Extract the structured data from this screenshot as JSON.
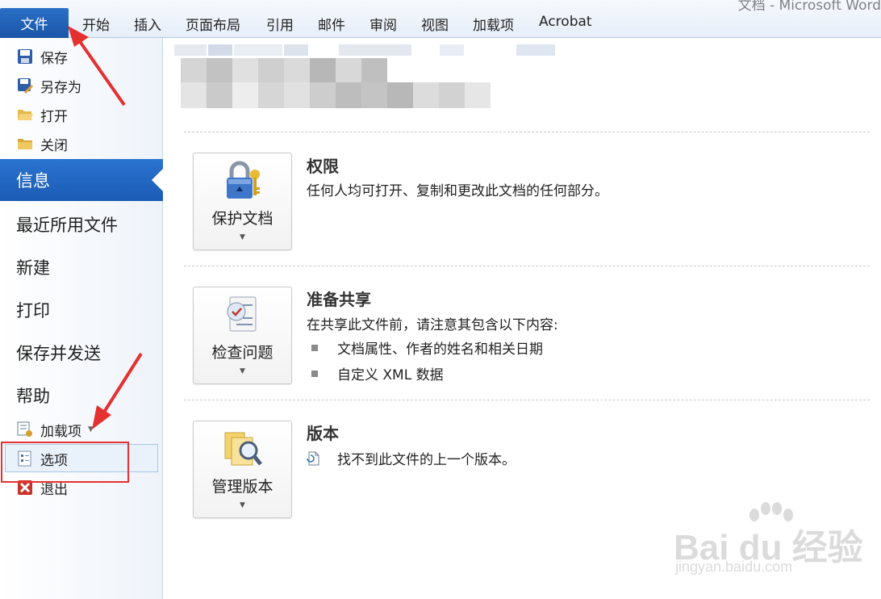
{
  "window": {
    "title_fragment": "文档 - Microsoft Word"
  },
  "ribbon": {
    "file_tab": "文件",
    "tabs": [
      "开始",
      "插入",
      "页面布局",
      "引用",
      "邮件",
      "审阅",
      "视图",
      "加载项",
      "Acrobat"
    ]
  },
  "backstage": {
    "commands_top": [
      {
        "label": "保存",
        "icon": "save-icon"
      },
      {
        "label": "另存为",
        "icon": "save-as-icon"
      },
      {
        "label": "打开",
        "icon": "open-folder-icon"
      },
      {
        "label": "关闭",
        "icon": "close-folder-icon"
      }
    ],
    "active_section": "信息",
    "sections": [
      "最近所用文件",
      "新建",
      "打印",
      "保存并发送",
      "帮助"
    ],
    "commands_bottom": [
      {
        "label": "加载项",
        "icon": "addins-icon",
        "has_dropdown": true
      },
      {
        "label": "选项",
        "icon": "options-icon"
      },
      {
        "label": "退出",
        "icon": "exit-icon"
      }
    ]
  },
  "info": {
    "permissions": {
      "button_label": "保护文档",
      "title": "权限",
      "description": "任何人均可打开、复制和更改此文档的任何部分。"
    },
    "prepare": {
      "button_label": "检查问题",
      "title": "准备共享",
      "description": "在共享此文件前，请注意其包含以下内容:",
      "bullets": [
        "文档属性、作者的姓名和相关日期",
        "自定义 XML 数据"
      ]
    },
    "versions": {
      "button_label": "管理版本",
      "title": "版本",
      "description": "找不到此文件的上一个版本。"
    }
  },
  "watermark": {
    "brand": "Bai du 经验",
    "url": "jingyan.baidu.com"
  },
  "colors": {
    "accent": "#1b5bb5",
    "annotation": "#e53030"
  }
}
